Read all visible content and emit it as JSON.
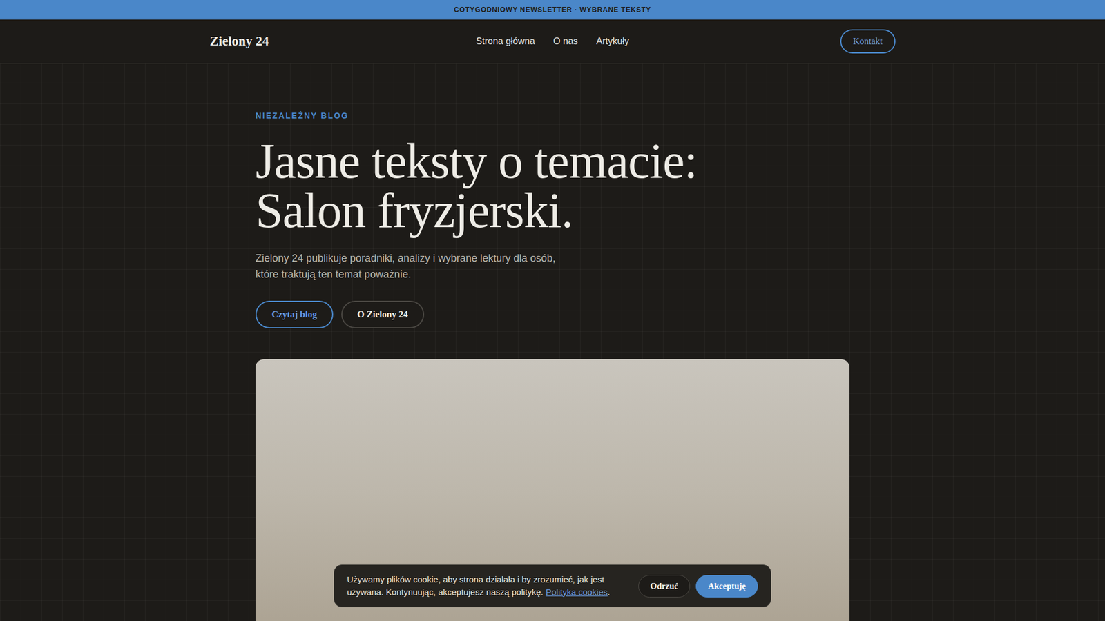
{
  "announcement": "COTYGODNIOWY NEWSLETTER · WYBRANE TEKSTY",
  "header": {
    "logo": "Zielony 24",
    "nav": [
      {
        "label": "Strona główna"
      },
      {
        "label": "O nas"
      },
      {
        "label": "Artykuły"
      }
    ],
    "cta": "Kontakt"
  },
  "hero": {
    "eyebrow": "NIEZALEŻNY BLOG",
    "title_lines": [
      "Jasne teksty o temacie:",
      "Salon fryzjerski."
    ],
    "lead": "Zielony 24 publikuje poradniki, analizy i wybrane lektury dla osób, które traktują ten temat poważnie.",
    "buttons": [
      {
        "label": "Czytaj blog",
        "kind": "primary"
      },
      {
        "label": "O Zielony 24",
        "kind": "secondary"
      }
    ]
  },
  "cookie": {
    "text": "Używamy plików cookie, aby strona działała i by zrozumieć, jak jest używana. Kontynuując, akceptujesz naszą politykę.",
    "link": "Polityka cookies",
    "after_link": ".",
    "buttons": [
      {
        "label": "Odrzuć",
        "kind": "secondary"
      },
      {
        "label": "Akceptuję",
        "kind": "primary"
      }
    ]
  }
}
